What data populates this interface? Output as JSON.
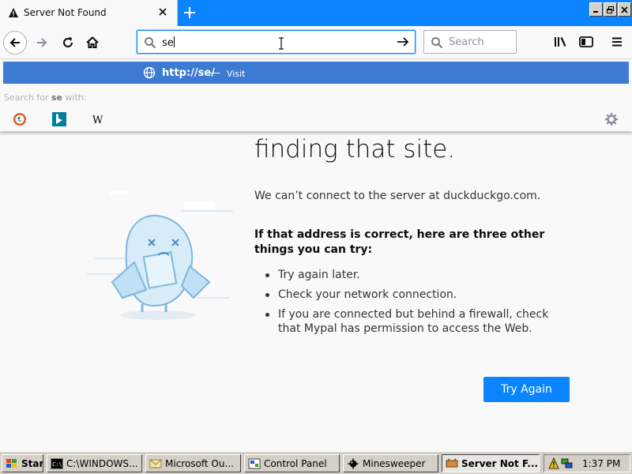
{
  "tab": {
    "title": "Server Not Found",
    "icon": "warning-icon"
  },
  "urlbar": {
    "value": "se"
  },
  "searchbar": {
    "placeholder": "Search"
  },
  "popup": {
    "suggestion_url": "http://se/",
    "suggestion_dash": "—",
    "suggestion_action": "Visit",
    "search_for_prefix": "Search for ",
    "search_for_term": "se",
    "search_for_suffix": " with:",
    "engines": [
      "duckduckgo-icon",
      "bing-icon",
      "wikipedia-icon"
    ]
  },
  "error": {
    "headline": "finding that site.",
    "message": "We can’t connect to the server at duckduckgo.com.",
    "subhead": "If that address is correct, here are three other things you can try:",
    "tips": [
      "Try again later.",
      "Check your network connection.",
      "If you are connected but behind a firewall, check that Mypal has permission to access the Web."
    ],
    "button": "Try Again"
  },
  "taskbar": {
    "start": "Start",
    "items": [
      "C:\\WINDOWS...",
      "Microsoft Ou...",
      "Control Panel",
      "Minesweeper",
      "Server Not F..."
    ],
    "clock": "1:37 PM"
  },
  "colors": {
    "accent": "#0a84ff",
    "suggest": "#3c7bd1",
    "taskbar": "#d4d0c8"
  }
}
